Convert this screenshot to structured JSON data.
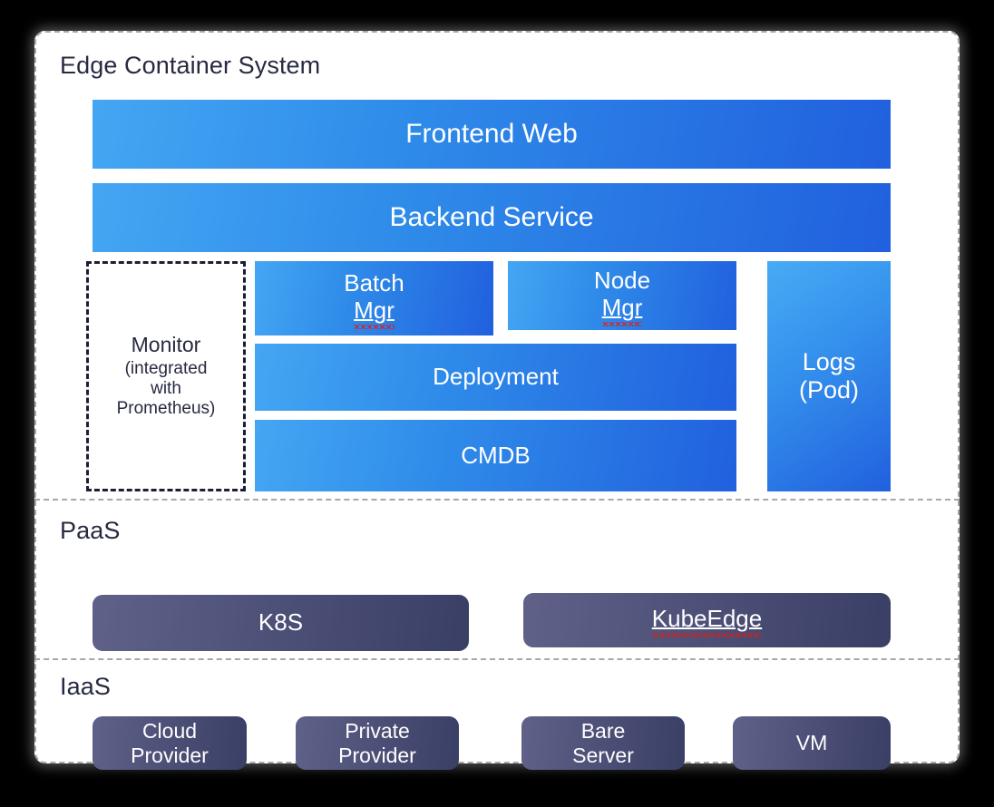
{
  "diagram": {
    "title": "Edge Container System Architecture",
    "background_color": "#000000",
    "card_color": "#ffffff"
  },
  "tiers": [
    {
      "id": "edge-container-system",
      "title": "Edge Container System",
      "blocks": [
        {
          "id": "frontend-web",
          "label": "Frontend Web",
          "style": "blue"
        },
        {
          "id": "backend-service",
          "label": "Backend Service",
          "style": "blue"
        },
        {
          "id": "monitor",
          "label": "Monitor",
          "sublabel": "(integrated\nwith\nPrometheus)",
          "style": "dashed-outline"
        },
        {
          "id": "batch-mgr",
          "label_line1": "Batch",
          "label_line2": "Mgr",
          "misspelled": "Mgr",
          "style": "blue"
        },
        {
          "id": "node-mgr",
          "label_line1": "Node",
          "label_line2": "Mgr",
          "misspelled": "Mgr",
          "style": "blue"
        },
        {
          "id": "deployment",
          "label": "Deployment",
          "style": "blue"
        },
        {
          "id": "cmdb",
          "label": "CMDB",
          "style": "blue"
        },
        {
          "id": "logs-pod",
          "label_line1": "Logs",
          "label_line2": "(Pod)",
          "style": "blue"
        }
      ]
    },
    {
      "id": "paas",
      "title": "PaaS",
      "blocks": [
        {
          "id": "k8s",
          "label": "K8S",
          "style": "slate"
        },
        {
          "id": "kubeedge",
          "label": "KubeEdge",
          "misspelled": "KubeEdge",
          "style": "slate"
        }
      ]
    },
    {
      "id": "iaas",
      "title": "IaaS",
      "blocks": [
        {
          "id": "cloud-provider",
          "label_line1": "Cloud",
          "label_line2": "Provider",
          "style": "slate"
        },
        {
          "id": "private-provider",
          "label_line1": "Private",
          "label_line2": "Provider",
          "style": "slate"
        },
        {
          "id": "bare-server",
          "label_line1": "Bare",
          "label_line2": "Server",
          "style": "slate"
        },
        {
          "id": "vm",
          "label": "VM",
          "style": "slate"
        }
      ]
    }
  ],
  "labels": {
    "edge_title": "Edge Container System",
    "paas_title": "PaaS",
    "iaas_title": "IaaS",
    "frontend_web": "Frontend Web",
    "backend_service": "Backend Service",
    "monitor_title": "Monitor",
    "monitor_sub_1": "(integrated",
    "monitor_sub_2": "with",
    "monitor_sub_3": "Prometheus)",
    "batch_1": "Batch",
    "batch_2": "Mgr",
    "node_1": "Node",
    "node_2": "Mgr",
    "deployment": "Deployment",
    "cmdb": "CMDB",
    "logs_1": "Logs",
    "logs_2": "(Pod)",
    "k8s": "K8S",
    "kubeedge": "KubeEdge",
    "cloud_1": "Cloud",
    "cloud_2": "Provider",
    "private_1": "Private",
    "private_2": "Provider",
    "bare_1": "Bare",
    "bare_2": "Server",
    "vm": "VM"
  },
  "colors": {
    "blue_light": "#44a6f3",
    "blue_dark": "#2160de",
    "slate_light": "#5f6189",
    "slate_dark": "#3a3f65",
    "text_dark": "#272a41",
    "dashed_border": "#a8a8a8",
    "monitor_border": "#1c1f33",
    "spellcheck_red": "#e8190f"
  }
}
